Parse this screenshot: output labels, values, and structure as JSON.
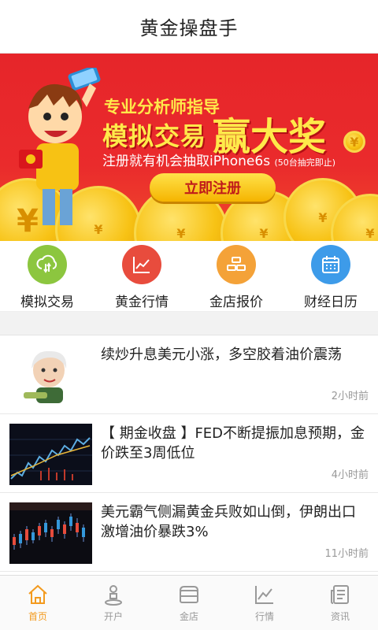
{
  "app": {
    "title": "黄金操盘手"
  },
  "banner": {
    "line1": "专业分析师指导",
    "line2_small": "模拟交易",
    "line2_big": "赢大奖",
    "line3": "注册就有机会抽取iPhone6s",
    "line3_note": "(50台抽完即止)",
    "cta": "立即注册",
    "colors": {
      "background": "#e6252a",
      "headline": "#ffe94a",
      "coin": "#f7c214"
    }
  },
  "quick_actions": [
    {
      "label": "模拟交易",
      "icon": "cloud-exchange-icon",
      "color": "#8cc63f"
    },
    {
      "label": "黄金行情",
      "icon": "line-chart-icon",
      "color": "#e84c3d"
    },
    {
      "label": "金店报价",
      "icon": "gold-bars-icon",
      "color": "#f4a238"
    },
    {
      "label": "财经日历",
      "icon": "calendar-icon",
      "color": "#3d9be9"
    }
  ],
  "news": [
    {
      "headline": "续炒升息美元小涨，多空胶着油价震荡",
      "time": "2小时前",
      "thumb": "cartoon-portrait"
    },
    {
      "headline": "【 期金收盘 】FED不断提振加息预期，金价跌至3周低位",
      "time": "4小时前",
      "thumb": "price-chart"
    },
    {
      "headline": "美元霸气侧漏黄金兵败如山倒，伊朗出口激增油价暴跌3%",
      "time": "11小时前",
      "thumb": "candlestick-chart"
    }
  ],
  "tabbar": {
    "active_color": "#f39a1e",
    "inactive_color": "#999999",
    "tabs": [
      {
        "label": "首页",
        "icon": "home-icon",
        "active": true
      },
      {
        "label": "开户",
        "icon": "person-icon",
        "active": false
      },
      {
        "label": "金店",
        "icon": "store-icon",
        "active": false
      },
      {
        "label": "行情",
        "icon": "trend-icon",
        "active": false
      },
      {
        "label": "资讯",
        "icon": "news-icon",
        "active": false
      }
    ]
  }
}
